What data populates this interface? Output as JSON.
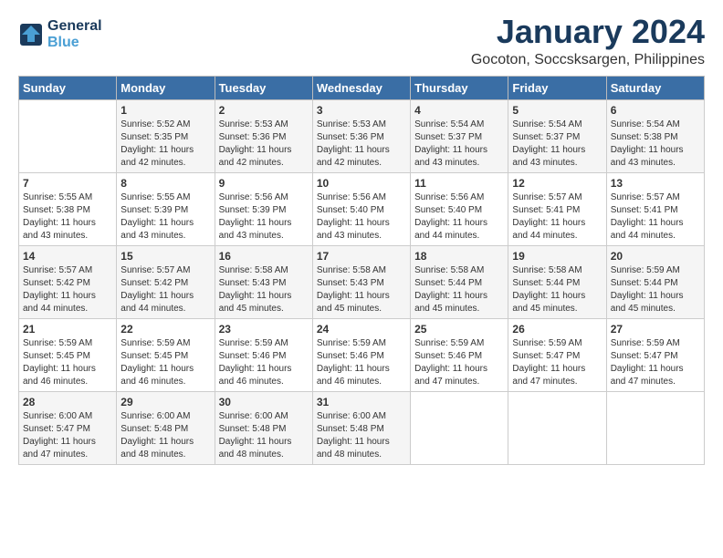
{
  "header": {
    "logo_line1": "General",
    "logo_line2": "Blue",
    "month": "January 2024",
    "location": "Gocoton, Soccsksargen, Philippines"
  },
  "days_of_week": [
    "Sunday",
    "Monday",
    "Tuesday",
    "Wednesday",
    "Thursday",
    "Friday",
    "Saturday"
  ],
  "weeks": [
    [
      {
        "day": "",
        "info": ""
      },
      {
        "day": "1",
        "info": "Sunrise: 5:52 AM\nSunset: 5:35 PM\nDaylight: 11 hours\nand 42 minutes."
      },
      {
        "day": "2",
        "info": "Sunrise: 5:53 AM\nSunset: 5:36 PM\nDaylight: 11 hours\nand 42 minutes."
      },
      {
        "day": "3",
        "info": "Sunrise: 5:53 AM\nSunset: 5:36 PM\nDaylight: 11 hours\nand 42 minutes."
      },
      {
        "day": "4",
        "info": "Sunrise: 5:54 AM\nSunset: 5:37 PM\nDaylight: 11 hours\nand 43 minutes."
      },
      {
        "day": "5",
        "info": "Sunrise: 5:54 AM\nSunset: 5:37 PM\nDaylight: 11 hours\nand 43 minutes."
      },
      {
        "day": "6",
        "info": "Sunrise: 5:54 AM\nSunset: 5:38 PM\nDaylight: 11 hours\nand 43 minutes."
      }
    ],
    [
      {
        "day": "7",
        "info": "Sunrise: 5:55 AM\nSunset: 5:38 PM\nDaylight: 11 hours\nand 43 minutes."
      },
      {
        "day": "8",
        "info": "Sunrise: 5:55 AM\nSunset: 5:39 PM\nDaylight: 11 hours\nand 43 minutes."
      },
      {
        "day": "9",
        "info": "Sunrise: 5:56 AM\nSunset: 5:39 PM\nDaylight: 11 hours\nand 43 minutes."
      },
      {
        "day": "10",
        "info": "Sunrise: 5:56 AM\nSunset: 5:40 PM\nDaylight: 11 hours\nand 43 minutes."
      },
      {
        "day": "11",
        "info": "Sunrise: 5:56 AM\nSunset: 5:40 PM\nDaylight: 11 hours\nand 44 minutes."
      },
      {
        "day": "12",
        "info": "Sunrise: 5:57 AM\nSunset: 5:41 PM\nDaylight: 11 hours\nand 44 minutes."
      },
      {
        "day": "13",
        "info": "Sunrise: 5:57 AM\nSunset: 5:41 PM\nDaylight: 11 hours\nand 44 minutes."
      }
    ],
    [
      {
        "day": "14",
        "info": "Sunrise: 5:57 AM\nSunset: 5:42 PM\nDaylight: 11 hours\nand 44 minutes."
      },
      {
        "day": "15",
        "info": "Sunrise: 5:57 AM\nSunset: 5:42 PM\nDaylight: 11 hours\nand 44 minutes."
      },
      {
        "day": "16",
        "info": "Sunrise: 5:58 AM\nSunset: 5:43 PM\nDaylight: 11 hours\nand 45 minutes."
      },
      {
        "day": "17",
        "info": "Sunrise: 5:58 AM\nSunset: 5:43 PM\nDaylight: 11 hours\nand 45 minutes."
      },
      {
        "day": "18",
        "info": "Sunrise: 5:58 AM\nSunset: 5:44 PM\nDaylight: 11 hours\nand 45 minutes."
      },
      {
        "day": "19",
        "info": "Sunrise: 5:58 AM\nSunset: 5:44 PM\nDaylight: 11 hours\nand 45 minutes."
      },
      {
        "day": "20",
        "info": "Sunrise: 5:59 AM\nSunset: 5:44 PM\nDaylight: 11 hours\nand 45 minutes."
      }
    ],
    [
      {
        "day": "21",
        "info": "Sunrise: 5:59 AM\nSunset: 5:45 PM\nDaylight: 11 hours\nand 46 minutes."
      },
      {
        "day": "22",
        "info": "Sunrise: 5:59 AM\nSunset: 5:45 PM\nDaylight: 11 hours\nand 46 minutes."
      },
      {
        "day": "23",
        "info": "Sunrise: 5:59 AM\nSunset: 5:46 PM\nDaylight: 11 hours\nand 46 minutes."
      },
      {
        "day": "24",
        "info": "Sunrise: 5:59 AM\nSunset: 5:46 PM\nDaylight: 11 hours\nand 46 minutes."
      },
      {
        "day": "25",
        "info": "Sunrise: 5:59 AM\nSunset: 5:46 PM\nDaylight: 11 hours\nand 47 minutes."
      },
      {
        "day": "26",
        "info": "Sunrise: 5:59 AM\nSunset: 5:47 PM\nDaylight: 11 hours\nand 47 minutes."
      },
      {
        "day": "27",
        "info": "Sunrise: 5:59 AM\nSunset: 5:47 PM\nDaylight: 11 hours\nand 47 minutes."
      }
    ],
    [
      {
        "day": "28",
        "info": "Sunrise: 6:00 AM\nSunset: 5:47 PM\nDaylight: 11 hours\nand 47 minutes."
      },
      {
        "day": "29",
        "info": "Sunrise: 6:00 AM\nSunset: 5:48 PM\nDaylight: 11 hours\nand 48 minutes."
      },
      {
        "day": "30",
        "info": "Sunrise: 6:00 AM\nSunset: 5:48 PM\nDaylight: 11 hours\nand 48 minutes."
      },
      {
        "day": "31",
        "info": "Sunrise: 6:00 AM\nSunset: 5:48 PM\nDaylight: 11 hours\nand 48 minutes."
      },
      {
        "day": "",
        "info": ""
      },
      {
        "day": "",
        "info": ""
      },
      {
        "day": "",
        "info": ""
      }
    ]
  ]
}
